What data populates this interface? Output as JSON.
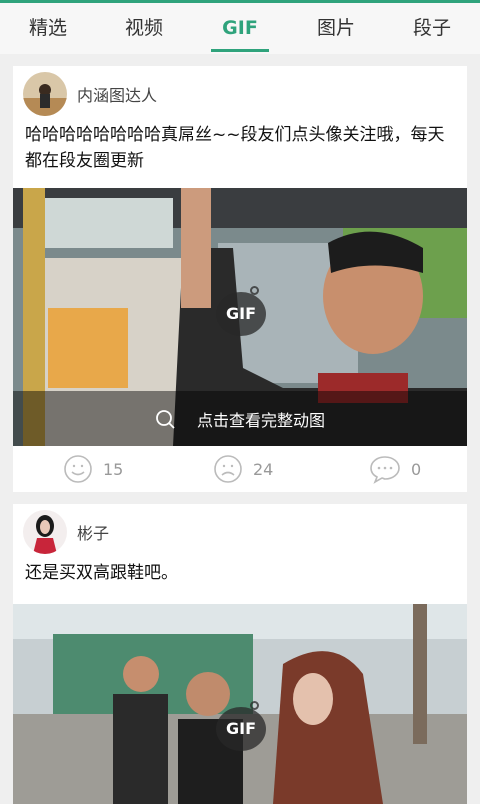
{
  "tabs": [
    {
      "label": "精选",
      "active": false
    },
    {
      "label": "视频",
      "active": false
    },
    {
      "label": "GIF",
      "active": true
    },
    {
      "label": "图片",
      "active": false
    },
    {
      "label": "段子",
      "active": false
    }
  ],
  "accent_color": "#2fa37c",
  "posts": [
    {
      "author": "内涵图达人",
      "text": "哈哈哈哈哈哈哈哈真屌丝~~段友们点头像关注哦，每天都在段友圈更新",
      "gif_badge": "GIF",
      "overlay_text": "点击查看完整动图",
      "likes": "15",
      "dislikes": "24",
      "comments": "0"
    },
    {
      "author": "彬子",
      "text": "还是买双高跟鞋吧。",
      "gif_badge": "GIF"
    }
  ],
  "icons": [
    "search-icon",
    "smile-icon",
    "sad-icon",
    "comment-icon"
  ]
}
